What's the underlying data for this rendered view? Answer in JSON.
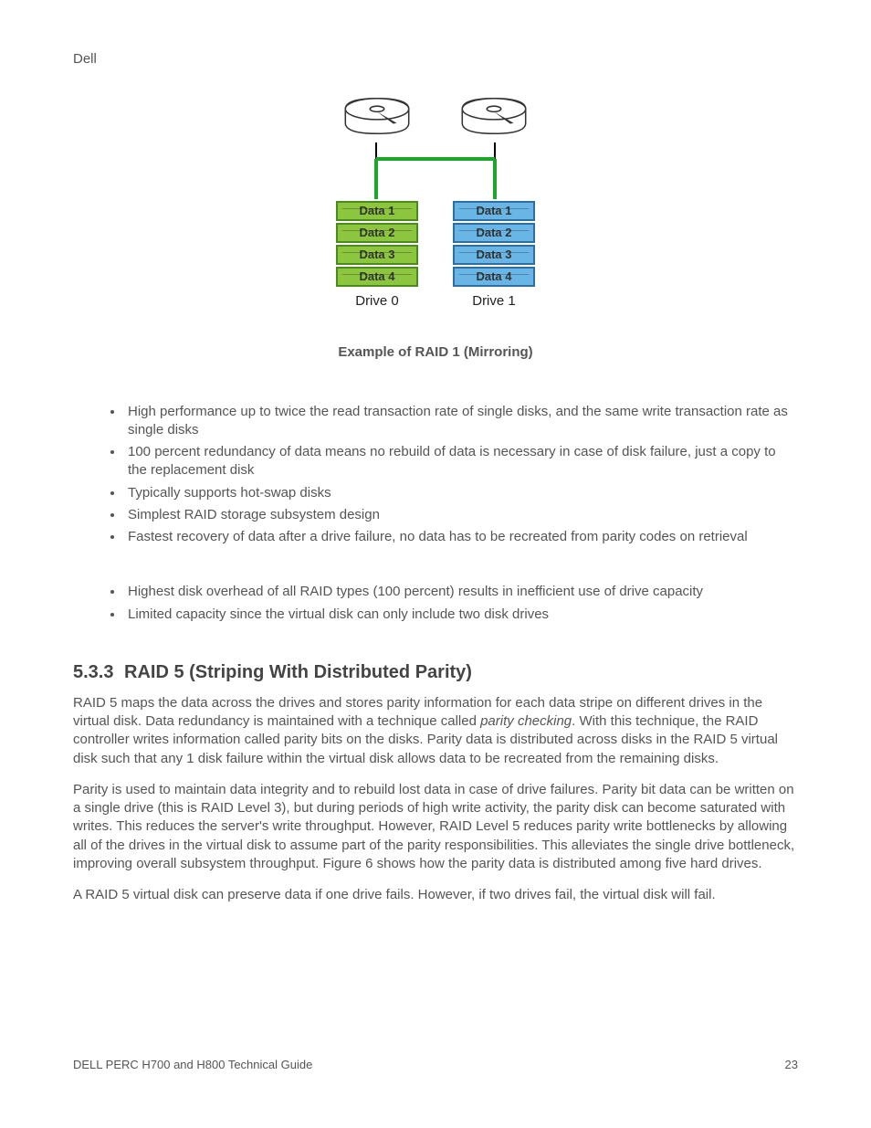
{
  "header": {
    "brand": "Dell"
  },
  "figure": {
    "caption": "Example of RAID 1 (Mirroring)",
    "stacks": [
      {
        "blocks": [
          "Data 1",
          "Data 2",
          "Data 3",
          "Data 4"
        ],
        "label": "Drive 0",
        "colorClass": "stack-green"
      },
      {
        "blocks": [
          "Data 1",
          "Data 2",
          "Data 3",
          "Data 4"
        ],
        "label": "Drive 1",
        "colorClass": "stack-blue"
      }
    ]
  },
  "bullets1": [
    "High performance up to twice the read transaction rate of single disks, and the same write transaction rate as single disks",
    "100 percent redundancy of data means no rebuild of data is necessary in case of disk failure, just a copy to the replacement disk",
    "Typically supports hot-swap disks",
    "Simplest RAID storage subsystem design",
    "Fastest recovery of data after a drive failure, no data has to be recreated from parity codes on retrieval"
  ],
  "bullets2": [
    "Highest disk overhead of all RAID types (100 percent) results in inefficient use of drive capacity",
    "Limited capacity since the virtual disk can only include two disk drives"
  ],
  "section": {
    "number": "5.3.3",
    "title": "RAID 5 (Striping With Distributed Parity)"
  },
  "paragraphs": {
    "p1_a": "RAID 5 maps the data across the drives and stores parity information for each data stripe on different drives in the virtual disk. Data redundancy is maintained with a technique called ",
    "p1_term": "parity checking",
    "p1_b": ". With this technique, the RAID controller writes information called parity bits on the disks. Parity data is distributed across disks in the RAID 5 virtual disk such that any 1 disk failure within the virtual disk allows data to be recreated from the remaining disks.",
    "p2": "Parity is used to maintain data integrity and to rebuild lost data in case of drive failures. Parity bit data can be written on a single drive (this is RAID Level 3), but during periods of high write activity, the parity disk can become saturated with writes. This reduces the server's write throughput. However, RAID Level 5 reduces parity write bottlenecks by allowing all of the drives in the virtual disk to assume part of the parity responsibilities. This alleviates the single drive bottleneck, improving overall subsystem throughput. Figure 6 shows how the parity data is distributed among five hard drives.",
    "p3": "A RAID 5 virtual disk can preserve data if one drive fails. However, if two drives fail, the virtual disk will fail."
  },
  "footer": {
    "doc": "DELL PERC H700 and H800 Technical Guide",
    "page": "23"
  }
}
